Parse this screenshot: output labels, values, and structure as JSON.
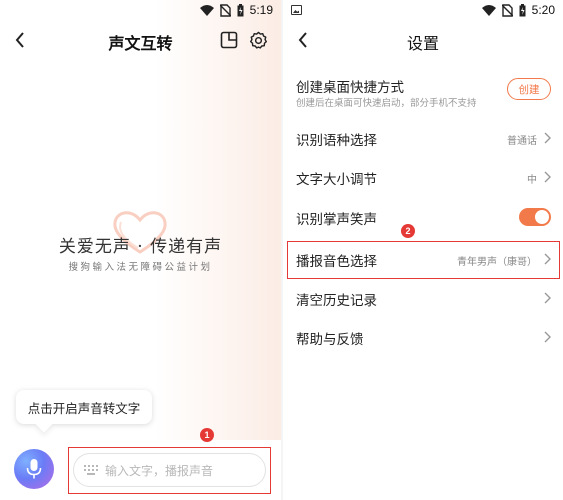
{
  "colors": {
    "accent": "#f27a4a",
    "annotation": "#e53935",
    "mic_gradient": [
      "#7fb0ff",
      "#6a7cf6",
      "#b86be6"
    ]
  },
  "left": {
    "status": {
      "time": "5:19"
    },
    "header": {
      "title": "声文互转",
      "icons": [
        "back-icon",
        "window-icon",
        "settings-gear-icon"
      ]
    },
    "hero": {
      "slogan": "关爱无声 · 传递有声",
      "subtitle": "搜狗输入法无障碍公益计划"
    },
    "tooltip": "点击开启声音转文字",
    "input": {
      "placeholder": "输入文字，播报声音"
    },
    "annotation_number": "1"
  },
  "right": {
    "status": {
      "time": "5:20"
    },
    "header": {
      "title": "设置"
    },
    "shortcut": {
      "label": "创建桌面快捷方式",
      "sublabel": "创建后在桌面可快速启动，部分手机不支持",
      "button": "创建"
    },
    "items": [
      {
        "label": "识别语种选择",
        "value": "普通话"
      },
      {
        "label": "文字大小调节",
        "value": "中"
      },
      {
        "label": "识别掌声笑声",
        "toggle": true
      },
      {
        "label": "播报音色选择",
        "value": "青年男声（康哥）"
      },
      {
        "label": "清空历史记录",
        "value": ""
      },
      {
        "label": "帮助与反馈",
        "value": ""
      }
    ],
    "annotation_number": "2"
  }
}
